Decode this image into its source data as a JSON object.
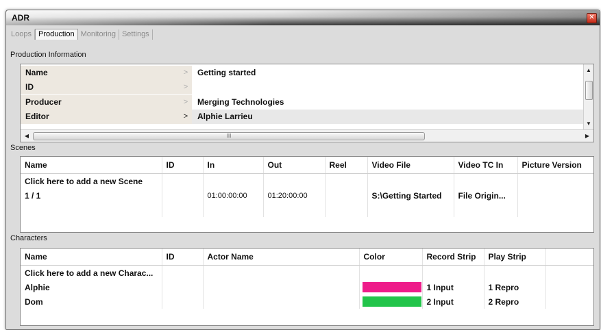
{
  "window": {
    "title": "ADR",
    "close_glyph": "✕"
  },
  "tabs": [
    {
      "label": "Loops",
      "active": false
    },
    {
      "label": "Production",
      "active": true
    },
    {
      "label": "Monitoring",
      "active": false
    },
    {
      "label": "Settings",
      "active": false
    }
  ],
  "production": {
    "section_label": "Production Information",
    "rows": [
      {
        "key": "Name",
        "arrow": ">",
        "value": "Getting started"
      },
      {
        "key": "ID",
        "arrow": ">",
        "value": ""
      },
      {
        "key": "Producer",
        "arrow": ">",
        "value": "Merging Technologies"
      },
      {
        "key": "Editor",
        "arrow": ">",
        "value": "Alphie Larrieu"
      }
    ],
    "hscroll_grip": "III",
    "scroll_up": "▲",
    "scroll_down": "▼",
    "scroll_left": "◀",
    "scroll_right": "▶"
  },
  "scenes": {
    "section_label": "Scenes",
    "columns": [
      "Name",
      "ID",
      "In",
      "Out",
      "Reel",
      "Video File",
      "Video TC In",
      "Picture Version"
    ],
    "add_row": "Click here to add a new Scene",
    "rows": [
      {
        "name": "1 / 1",
        "id": "",
        "in": "01:00:00:00",
        "out": "01:20:00:00",
        "reel": "",
        "video_file": "S:\\Getting Started",
        "video_tc_in": "File Origin...",
        "picture_version": ""
      }
    ]
  },
  "characters": {
    "section_label": "Characters",
    "columns": [
      "Name",
      "ID",
      "Actor Name",
      "Color",
      "Record Strip",
      "Play Strip"
    ],
    "add_row": "Click here to add a new Charac...",
    "rows": [
      {
        "name": "Alphie",
        "id": "",
        "actor": "",
        "color": "#ee1c8a",
        "record_strip": "1 Input",
        "play_strip": "1 Repro"
      },
      {
        "name": "Dom",
        "id": "",
        "actor": "",
        "color": "#22c44a",
        "record_strip": "2 Input",
        "play_strip": "2 Repro"
      }
    ]
  }
}
